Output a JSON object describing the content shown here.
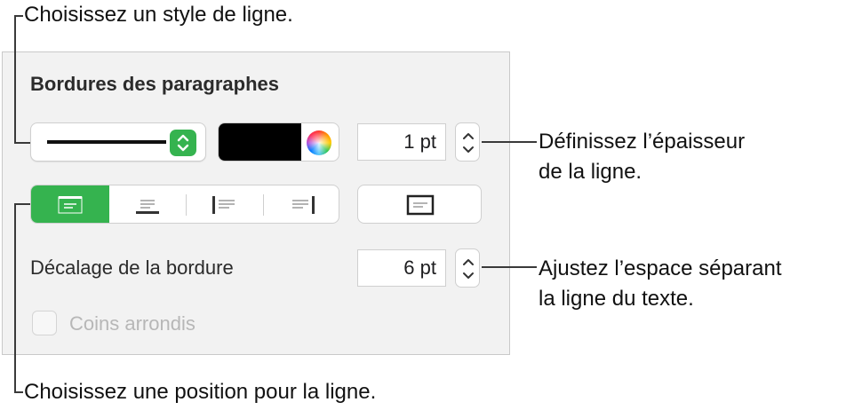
{
  "callouts": {
    "line_style": "Choisissez un style de ligne.",
    "thickness_line1": "Définissez l’épaisseur",
    "thickness_line2": "de la ligne.",
    "offset_line1": "Ajustez l’espace séparant",
    "offset_line2": "la ligne du texte.",
    "position": "Choisissez une position pour la ligne."
  },
  "panel": {
    "title": "Bordures des paragraphes",
    "line_style_popup": {
      "selected": "solid-line",
      "icon": "up-down-arrows-icon"
    },
    "color_well": {
      "color": "#000000",
      "picker_icon": "color-wheel-icon"
    },
    "thickness": {
      "value": "1 pt"
    },
    "position_segments": [
      "border-top",
      "border-bottom",
      "border-left",
      "border-right"
    ],
    "selected_position": "border-top",
    "all_borders_button": "all-borders",
    "offset": {
      "label": "Décalage de la bordure",
      "value": "6 pt"
    },
    "rounded_corners": {
      "label": "Coins arrondis",
      "checked": false,
      "enabled": false
    }
  },
  "colors": {
    "accent": "#35b34f",
    "panel_bg": "#f2f2f2",
    "border": "#cfcfcf"
  }
}
